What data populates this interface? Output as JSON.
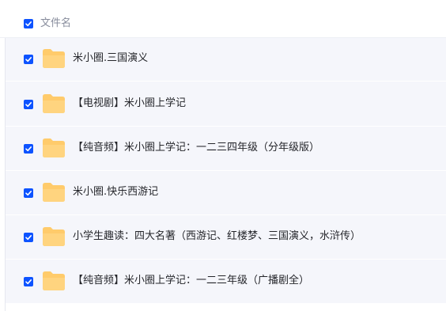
{
  "header": {
    "column_label": "文件名",
    "select_all_checked": true
  },
  "files": [
    {
      "name": "米小圈.三国演义",
      "checked": true,
      "icon": "folder-icon"
    },
    {
      "name": "【电视剧】米小圈上学记",
      "checked": true,
      "icon": "folder-icon"
    },
    {
      "name": "【纯音频】米小圈上学记：一二三四年级（分年级版）",
      "checked": true,
      "icon": "folder-icon"
    },
    {
      "name": "米小圈.快乐西游记",
      "checked": true,
      "icon": "folder-icon"
    },
    {
      "name": "小学生趣读：四大名著（西游记、红楼梦、三国演义，水浒传）",
      "checked": true,
      "icon": "folder-icon"
    },
    {
      "name": "【纯音频】米小圈上学记：一二三年级（广播剧全）",
      "checked": true,
      "icon": "folder-icon"
    }
  ],
  "colors": {
    "accent": "#0d53ff",
    "folder": "#ffcb6b",
    "row_background": "#f5f6fb",
    "header_text": "#878c9c",
    "row_text": "#25262b"
  }
}
